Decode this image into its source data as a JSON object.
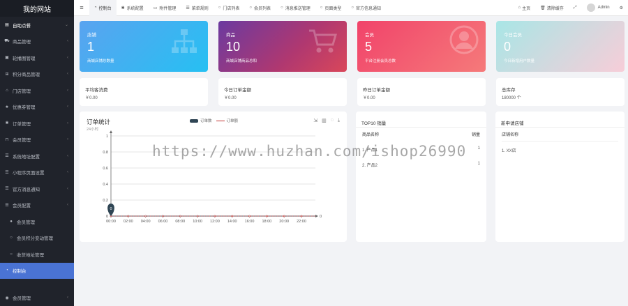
{
  "sidebar": {
    "brand": "我的网站",
    "items": [
      {
        "label": "自助点餐",
        "icon": "book-icon",
        "type": "top"
      },
      {
        "label": "商品管理",
        "icon": "cart-icon",
        "type": "sub"
      },
      {
        "label": "轮播图管理",
        "icon": "image-icon",
        "type": "sub"
      },
      {
        "label": "积分商品管理",
        "icon": "gift-icon",
        "type": "sub"
      },
      {
        "label": "门店管理",
        "icon": "store-icon",
        "type": "sub"
      },
      {
        "label": "优惠券管理",
        "icon": "star-icon",
        "type": "sub"
      },
      {
        "label": "订单管理",
        "icon": "gear-icon",
        "type": "sub"
      },
      {
        "label": "会员管理",
        "icon": "door-icon",
        "type": "sub"
      },
      {
        "label": "系统地址配置",
        "icon": "list-icon",
        "type": "sub"
      },
      {
        "label": "小程序页面设置",
        "icon": "list-icon",
        "type": "sub"
      },
      {
        "label": "官方消息通知",
        "icon": "list-icon",
        "type": "sub"
      },
      {
        "label": "会员配置",
        "icon": "list-icon",
        "type": "sub"
      },
      {
        "label": "会员管理",
        "icon": "user-icon",
        "type": "sub2"
      },
      {
        "label": "会员积分变动管理",
        "icon": "circle-icon",
        "type": "sub2"
      },
      {
        "label": "收货地址管理",
        "icon": "circle-icon",
        "type": "sub2"
      },
      {
        "label": "控制台",
        "icon": "dashboard-icon",
        "type": "active"
      }
    ],
    "bottom": {
      "label": "会员管理",
      "icon": "user-circle-icon"
    }
  },
  "topbar": {
    "tabs": [
      {
        "label": "控制台",
        "icon": "dashboard-icon",
        "active": true
      },
      {
        "label": "系统配置",
        "icon": "gear-icon"
      },
      {
        "label": "附件管理",
        "icon": "file-icon"
      },
      {
        "label": "菜单规则",
        "icon": "list-icon"
      },
      {
        "label": "门店列表",
        "icon": "circle-icon"
      },
      {
        "label": "会员列表",
        "icon": "circle-icon"
      },
      {
        "label": "消息推送管理",
        "icon": "circle-icon"
      },
      {
        "label": "页面类型",
        "icon": "circle-icon"
      },
      {
        "label": "官方信息通知",
        "icon": "circle-icon"
      }
    ],
    "home": "主页",
    "clear_cache": "清除缓存",
    "user": "Admin"
  },
  "cards": [
    {
      "label": "店铺",
      "value": "1",
      "desc": "商城店铺总数量"
    },
    {
      "label": "商品",
      "value": "10",
      "desc": "商城店铺商品总和"
    },
    {
      "label": "会员",
      "value": "5",
      "desc": "平台注册会员总数"
    },
    {
      "label": "今日会员",
      "value": "0",
      "desc": "今日新增用户数量"
    }
  ],
  "info": [
    {
      "label": "平均客消费",
      "value": "￥0.00"
    },
    {
      "label": "今日订单金额",
      "value": "￥0.00"
    },
    {
      "label": "昨日订单金额",
      "value": "￥0.00"
    },
    {
      "label": "总库存",
      "value": "180000 个"
    }
  ],
  "chart_panel": {
    "title": "订单统计",
    "subtitle": "24小时",
    "tools": [
      "⇲",
      "▥",
      "◌",
      "⤓"
    ]
  },
  "chart_data": {
    "type": "line",
    "categories": [
      "00:00",
      "02:00",
      "04:00",
      "06:00",
      "08:00",
      "10:00",
      "12:00",
      "14:00",
      "16:00",
      "18:00",
      "20:00",
      "22:00"
    ],
    "ylim": [
      0,
      1
    ],
    "yticks": [
      "0",
      "0.2",
      "0.4",
      "0.6",
      "0.8",
      "1"
    ],
    "series": [
      {
        "name": "订单数",
        "values": [
          0,
          0,
          0,
          0,
          0,
          0,
          0,
          0,
          0,
          0,
          0,
          0
        ],
        "color": "#2f4554"
      },
      {
        "name": "订单额",
        "values": [
          0,
          0,
          0,
          0,
          0,
          0,
          0,
          0,
          0,
          0,
          0,
          0
        ],
        "color": "#c23531"
      }
    ],
    "marker_label": "0",
    "end_label": "0"
  },
  "top10": {
    "title": "TOP10 销量",
    "col_name": "商品名称",
    "col_sales": "销量",
    "rows": [
      {
        "name": "1. 产品1",
        "sales": "1"
      },
      {
        "name": "2. 产品2",
        "sales": "1"
      }
    ]
  },
  "new_stores": {
    "title": "新申请店铺",
    "col_name": "店铺名称",
    "rows": [
      "1. XX店"
    ]
  },
  "watermark": "https://www.huzhan.com/ishop26990"
}
